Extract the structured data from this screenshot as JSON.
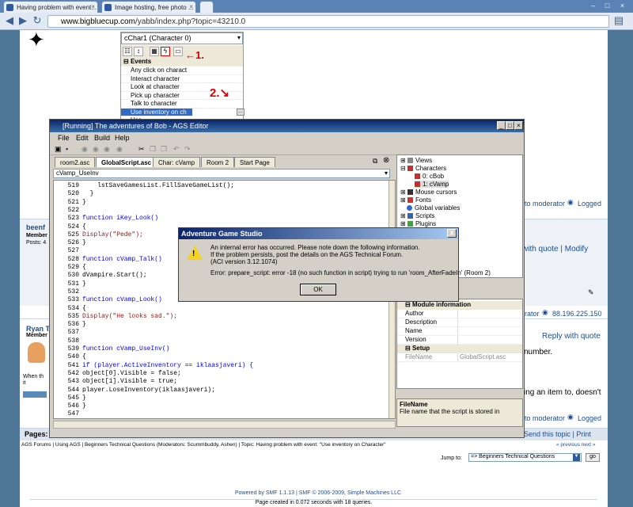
{
  "browser": {
    "tabs": [
      "Having problem with event...",
      "Image hosting, free photo ...",
      ""
    ],
    "url_domain": "www.bigbluecup.com",
    "url_path": "/yabb/index.php?topic=43210.0"
  },
  "properties_panel": {
    "selector": "cChar1 (Character 0)",
    "section": "Events",
    "items": [
      "Any click on charact",
      "Interact character",
      "Look at character",
      "Pick up character",
      "Talk to character",
      "Use inventory on ch",
      "Use ..."
    ],
    "annotation1": "1.",
    "annotation2": "2."
  },
  "editor": {
    "title": "[Running] The adventures of Bob - AGS Editor",
    "menu": [
      "File",
      "Edit",
      "Build",
      "Help"
    ],
    "tabs": [
      "room2.asc",
      "GlobalScript.asc",
      "Char: cVamp",
      "Room 2",
      "Start Page"
    ],
    "active_tab": "GlobalScript.asc",
    "function_selector": "cVamp_UseInv",
    "lines": [
      {
        "n": "519",
        "code": "    lstSaveGamesList.FillSaveGameList();"
      },
      {
        "n": "520",
        "code": "  }"
      },
      {
        "n": "521",
        "code": "}"
      },
      {
        "n": "522",
        "code": ""
      },
      {
        "n": "523",
        "code": "function iKey_Look()"
      },
      {
        "n": "524",
        "code": "{"
      },
      {
        "n": "525",
        "code": "Display(\"Pede\");"
      },
      {
        "n": "526",
        "code": "}"
      },
      {
        "n": "527",
        "code": ""
      },
      {
        "n": "528",
        "code": "function cVamp_Talk()"
      },
      {
        "n": "529",
        "code": "{"
      },
      {
        "n": "530",
        "code": "dVampire.Start();"
      },
      {
        "n": "531",
        "code": "}"
      },
      {
        "n": "532",
        "code": ""
      },
      {
        "n": "533",
        "code": "function cVamp_Look()"
      },
      {
        "n": "534",
        "code": "{"
      },
      {
        "n": "535",
        "code": "Display(\"He looks sad.\");"
      },
      {
        "n": "536",
        "code": "}"
      },
      {
        "n": "537",
        "code": ""
      },
      {
        "n": "538",
        "code": ""
      },
      {
        "n": "539",
        "code": "function cVamp_UseInv()"
      },
      {
        "n": "540",
        "code": "{"
      },
      {
        "n": "541",
        "code": "if (player.ActiveInventory == iklaasjaveri) {"
      },
      {
        "n": "542",
        "code": "object[0].Visible = false;"
      },
      {
        "n": "543",
        "code": "object[1].Visible = true;"
      },
      {
        "n": "544",
        "code": "player.LoseInventory(iklaasjaveri);"
      },
      {
        "n": "545",
        "code": "}"
      },
      {
        "n": "546",
        "code": "}"
      },
      {
        "n": "547",
        "code": ""
      }
    ],
    "tree": [
      "Views",
      "Characters",
      "0: cBob",
      "1: cVamp",
      "Mouse cursors",
      "Fonts",
      "Global variables",
      "Scripts",
      "Plugins"
    ],
    "module_info": {
      "header": "Module information",
      "rows": [
        "Author",
        "Description",
        "Name",
        "Version"
      ],
      "setup_header": "Setup",
      "filename_label": "FileName",
      "filename_value": "GlobalScript.asc"
    },
    "desc_title": "FileName",
    "desc_text": "File name that the script is stored in"
  },
  "dialog": {
    "title": "Adventure Game Studio",
    "line1": "An internal error has occurred. Please note down the following information.",
    "line2": "If the problem persists, post the details on the AGS Technical Forum.",
    "line3": "(ACI version 3.12.1074)",
    "line4": "Error: prepare_script: error -18 (no such function in script) trying to run 'room_AfterFadeIn'   (Room 2)",
    "ok": "OK",
    "close": "X"
  },
  "forum": {
    "to_moderator": "to moderator",
    "logged": "Logged",
    "reply_quote_modify": "ly with quote | Modify",
    "user1": "beenf",
    "member": "Member",
    "posts": "Posts: 4",
    "moderator_ip": "rator",
    "ip": "88.196.225.150",
    "user2": "Ryan T",
    "reply_quote": "Reply with quote",
    "number": "number.",
    "when_the": "When th",
    "it": "it",
    "an_item": "ing an item to, doesn't",
    "to_moderator2": "to moderator",
    "logged2": "Logged",
    "pages": "Pages:",
    "send_print": "Send this topic | Print",
    "breadcrumb": "AGS Forums | Using AGS | Beginners Technical Questions (Moderators: Scummbuddy, Ashen) | Topic: Having problem with event: \"Use inventory on Character\"",
    "prev_next": "« previous next »",
    "jump_to": "Jump to:",
    "jump_value": "=> Beginners Technical Questions",
    "go": "go",
    "powered": "Powered by SMF 1.1.13 | SMF © 2006-2009, Simple Machines LLC",
    "created": "Page created in 0.072 seconds with 18 queries."
  }
}
